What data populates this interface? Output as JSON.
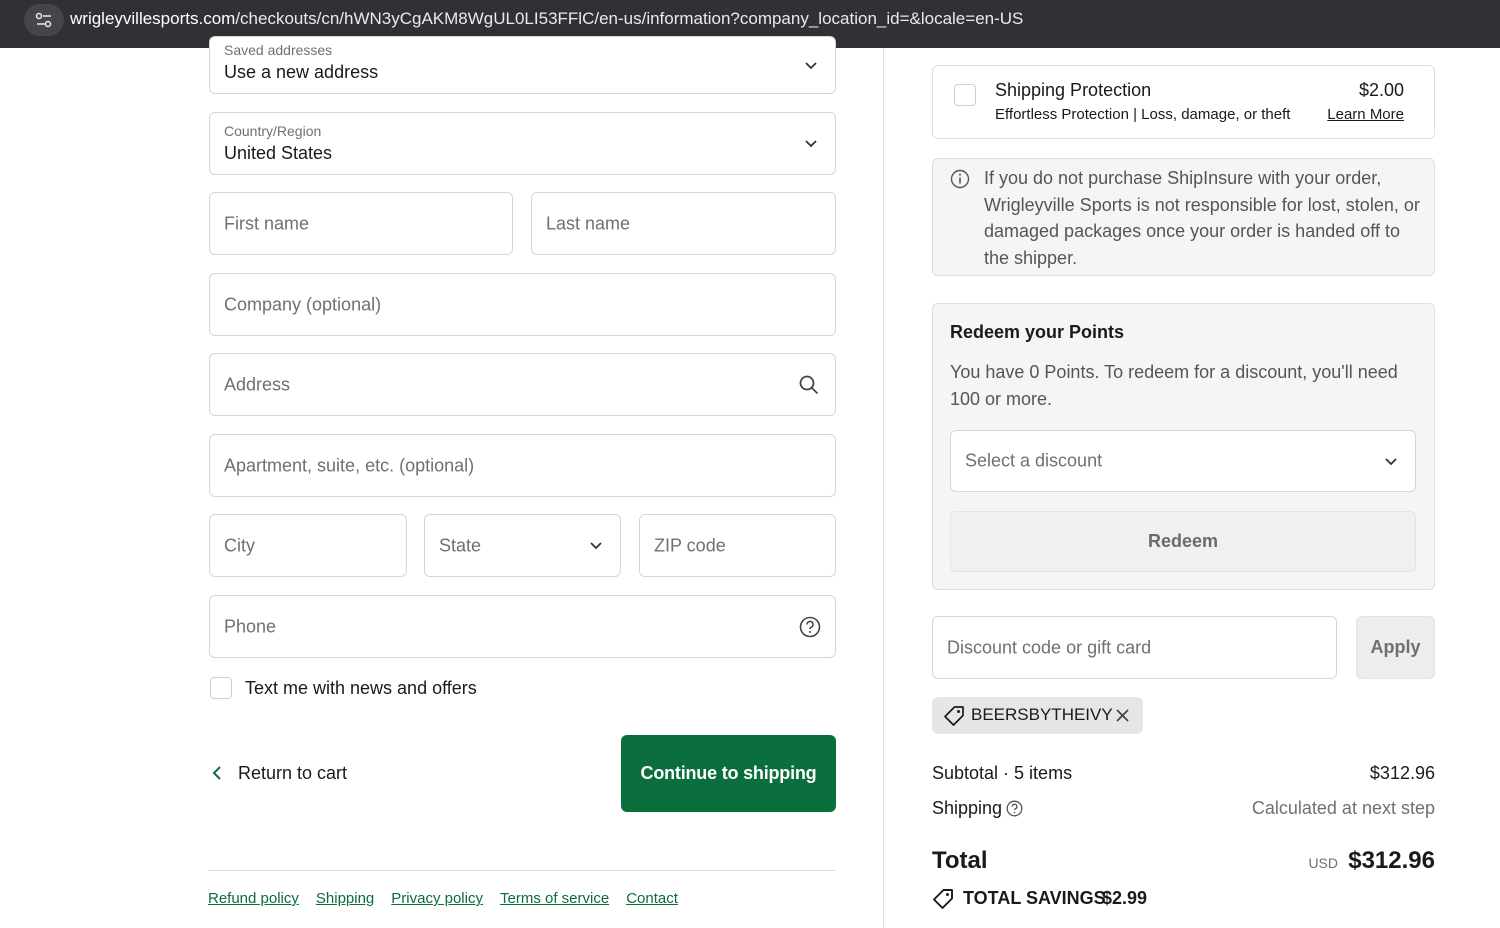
{
  "browser": {
    "url_domain": "wrigleyvillesports.com",
    "url_path": "/checkouts/cn/hWN3yCgAKM8WgUL0LI53FFlC/en-us/information?company_location_id=&locale=en-US"
  },
  "form": {
    "saved_addresses": {
      "label": "Saved addresses",
      "value": "Use a new address"
    },
    "country": {
      "label": "Country/Region",
      "value": "United States"
    },
    "first_name": {
      "placeholder": "First name"
    },
    "last_name": {
      "placeholder": "Last name"
    },
    "company": {
      "placeholder": "Company (optional)"
    },
    "address": {
      "placeholder": "Address"
    },
    "apartment": {
      "placeholder": "Apartment, suite, etc. (optional)"
    },
    "city": {
      "placeholder": "City"
    },
    "state": {
      "placeholder": "State"
    },
    "zip": {
      "placeholder": "ZIP code"
    },
    "phone": {
      "placeholder": "Phone"
    },
    "sms_opt_in": {
      "label": "Text me with news and offers",
      "checked": false
    },
    "return_link": "Return to cart",
    "continue_button": "Continue to shipping"
  },
  "footer": {
    "links": [
      "Refund policy",
      "Shipping",
      "Privacy policy",
      "Terms of service",
      "Contact"
    ]
  },
  "summary": {
    "shipping_protection": {
      "title": "Shipping Protection",
      "subtitle": "Effortless Protection | Loss, damage, or theft",
      "price": "$2.00",
      "learn_more": "Learn More",
      "checked": false
    },
    "info_notice": "If you do not purchase ShipInsure with your order, Wrigleyville Sports is not responsible for lost, stolen, or damaged packages once your order is handed off to the shipper.",
    "redeem": {
      "title": "Redeem your Points",
      "text": "You have 0 Points. To redeem for a discount, you'll need 100 or more.",
      "select_placeholder": "Select a discount",
      "button": "Redeem"
    },
    "discount": {
      "placeholder": "Discount code or gift card",
      "apply": "Apply",
      "applied_code": "BEERSBYTHEIVY"
    },
    "subtotal_label": "Subtotal · 5 items",
    "subtotal_value": "$312.96",
    "shipping_label": "Shipping",
    "shipping_value": "Calculated at next step",
    "total_label": "Total",
    "total_currency": "USD",
    "total_value": "$312.96",
    "savings_label": "TOTAL SAVINGS",
    "savings_value": "$2.99"
  },
  "colors": {
    "accent_green": "#0b6e3d",
    "browser_bar": "#303134",
    "panel_gray": "#f5f5f5"
  }
}
